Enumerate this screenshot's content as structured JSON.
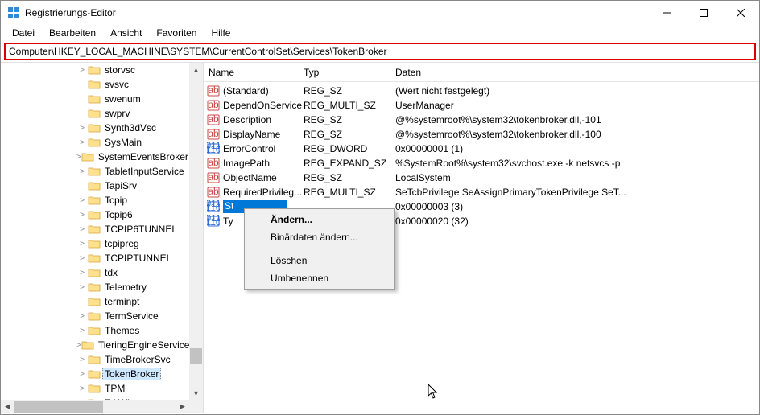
{
  "window": {
    "title": "Registrierungs-Editor"
  },
  "menu": {
    "items": [
      "Datei",
      "Bearbeiten",
      "Ansicht",
      "Favoriten",
      "Hilfe"
    ]
  },
  "address": {
    "path": "Computer\\HKEY_LOCAL_MACHINE\\SYSTEM\\CurrentControlSet\\Services\\TokenBroker"
  },
  "tree": {
    "items": [
      {
        "indent": 94,
        "exp": ">",
        "label": "storvsc"
      },
      {
        "indent": 94,
        "exp": "",
        "label": "svsvc"
      },
      {
        "indent": 94,
        "exp": "",
        "label": "swenum"
      },
      {
        "indent": 94,
        "exp": "",
        "label": "swprv"
      },
      {
        "indent": 94,
        "exp": ">",
        "label": "Synth3dVsc"
      },
      {
        "indent": 94,
        "exp": ">",
        "label": "SysMain"
      },
      {
        "indent": 94,
        "exp": ">",
        "label": "SystemEventsBroker"
      },
      {
        "indent": 94,
        "exp": ">",
        "label": "TabletInputService"
      },
      {
        "indent": 94,
        "exp": "",
        "label": "TapiSrv"
      },
      {
        "indent": 94,
        "exp": ">",
        "label": "Tcpip"
      },
      {
        "indent": 94,
        "exp": ">",
        "label": "Tcpip6"
      },
      {
        "indent": 94,
        "exp": ">",
        "label": "TCPIP6TUNNEL"
      },
      {
        "indent": 94,
        "exp": ">",
        "label": "tcpipreg"
      },
      {
        "indent": 94,
        "exp": ">",
        "label": "TCPIPTUNNEL"
      },
      {
        "indent": 94,
        "exp": ">",
        "label": "tdx"
      },
      {
        "indent": 94,
        "exp": ">",
        "label": "Telemetry"
      },
      {
        "indent": 94,
        "exp": "",
        "label": "terminpt"
      },
      {
        "indent": 94,
        "exp": ">",
        "label": "TermService"
      },
      {
        "indent": 94,
        "exp": ">",
        "label": "Themes"
      },
      {
        "indent": 94,
        "exp": ">",
        "label": "TieringEngineService"
      },
      {
        "indent": 94,
        "exp": ">",
        "label": "TimeBrokerSvc"
      },
      {
        "indent": 94,
        "exp": ">",
        "label": "TokenBroker",
        "selected": true
      },
      {
        "indent": 94,
        "exp": ">",
        "label": "TPM"
      },
      {
        "indent": 94,
        "exp": ">",
        "label": "TrkWks"
      }
    ]
  },
  "list": {
    "columns": {
      "name": "Name",
      "typ": "Typ",
      "daten": "Daten"
    },
    "rows": [
      {
        "icon": "str",
        "name": "(Standard)",
        "typ": "REG_SZ",
        "daten": "(Wert nicht festgelegt)"
      },
      {
        "icon": "str",
        "name": "DependOnService",
        "typ": "REG_MULTI_SZ",
        "daten": "UserManager"
      },
      {
        "icon": "str",
        "name": "Description",
        "typ": "REG_SZ",
        "daten": "@%systemroot%\\system32\\tokenbroker.dll,-101"
      },
      {
        "icon": "str",
        "name": "DisplayName",
        "typ": "REG_SZ",
        "daten": "@%systemroot%\\system32\\tokenbroker.dll,-100"
      },
      {
        "icon": "bin",
        "name": "ErrorControl",
        "typ": "REG_DWORD",
        "daten": "0x00000001 (1)"
      },
      {
        "icon": "str",
        "name": "ImagePath",
        "typ": "REG_EXPAND_SZ",
        "daten": "%SystemRoot%\\system32\\svchost.exe -k netsvcs -p"
      },
      {
        "icon": "str",
        "name": "ObjectName",
        "typ": "REG_SZ",
        "daten": "LocalSystem"
      },
      {
        "icon": "str",
        "name": "RequiredPrivileg...",
        "typ": "REG_MULTI_SZ",
        "daten": "SeTcbPrivilege SeAssignPrimaryTokenPrivilege SeT..."
      },
      {
        "icon": "bin",
        "name": "St",
        "typ": "",
        "daten": "0x00000003 (3)",
        "selected": true
      },
      {
        "icon": "bin",
        "name": "Ty",
        "typ": "",
        "daten": "0x00000020 (32)"
      }
    ]
  },
  "context_menu": {
    "items": [
      {
        "label": "Ändern...",
        "bold": true
      },
      {
        "label": "Binärdaten ändern..."
      },
      {
        "sep": true
      },
      {
        "label": "Löschen"
      },
      {
        "label": "Umbenennen"
      }
    ]
  }
}
